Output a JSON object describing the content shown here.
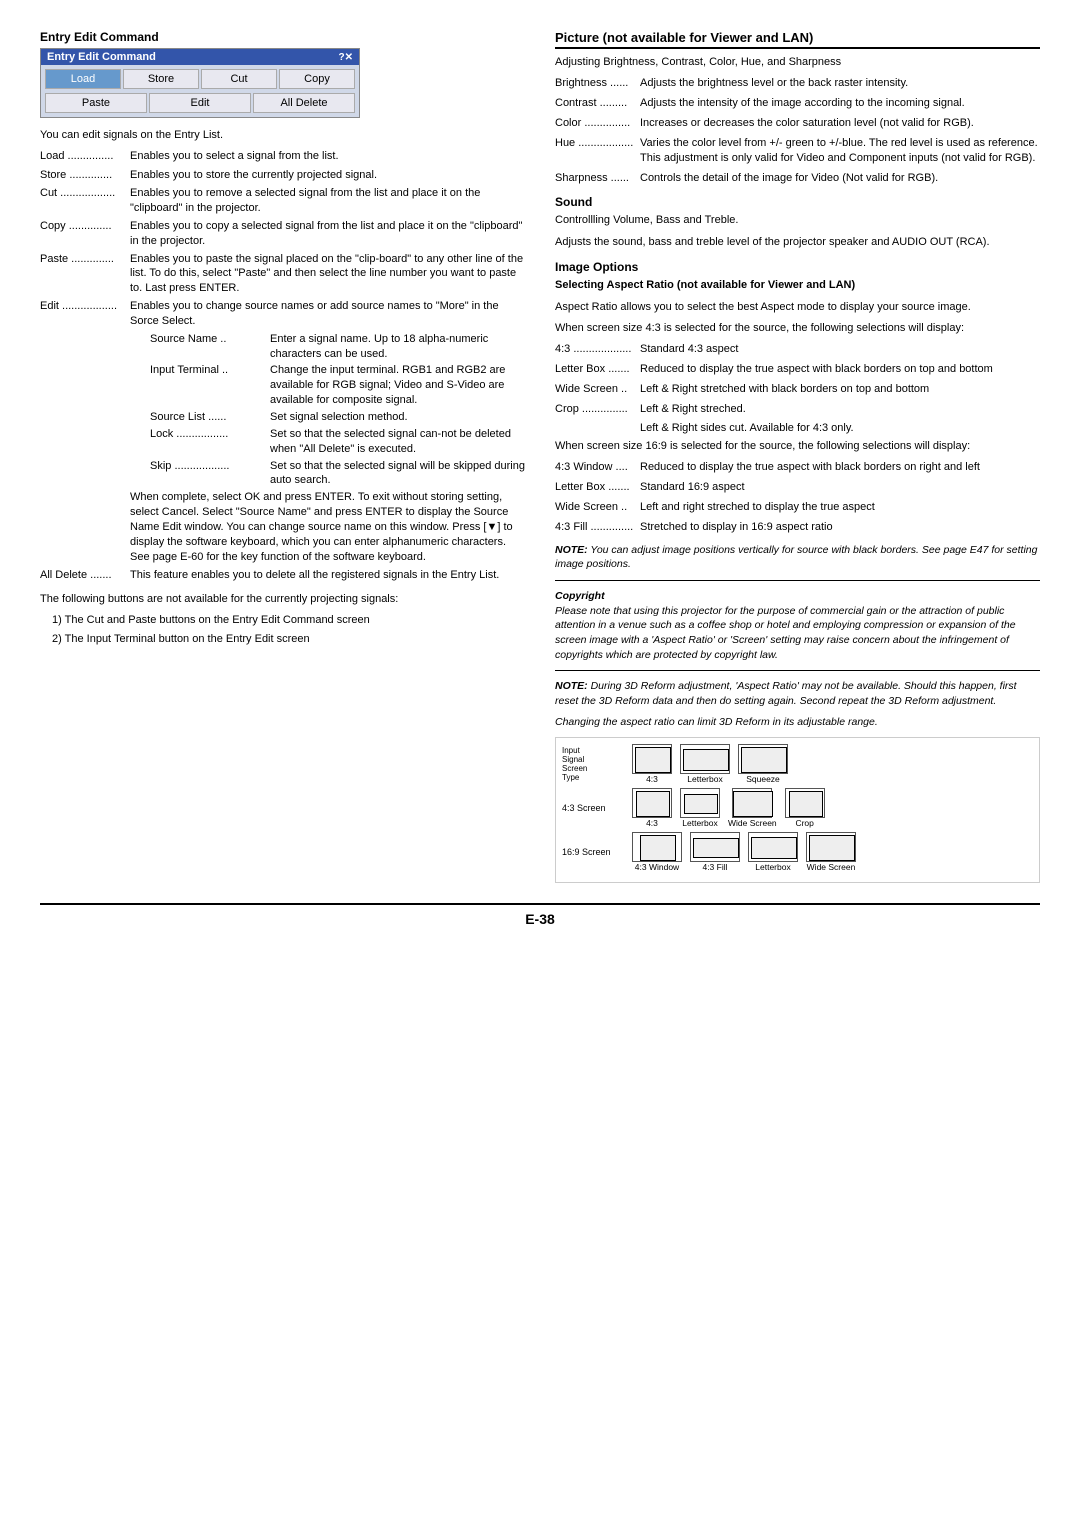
{
  "left": {
    "section_title": "Entry Edit Command",
    "buttons_row1": [
      "Load",
      "Store",
      "Cut",
      "Copy"
    ],
    "buttons_row2": [
      "Paste",
      "Edit",
      "All Delete"
    ],
    "intro": "You can edit signals on the Entry List.",
    "items": [
      {
        "term": "Load ...............",
        "def": "Enables you to select a signal from the list."
      },
      {
        "term": "Store ..............",
        "def": "Enables you to store the currently projected signal."
      },
      {
        "term": "Cut ..................",
        "def": "Enables you to remove a selected signal from the list and place it on the \"clipboard\" in the projector."
      },
      {
        "term": "Copy ..............",
        "def": "Enables you to copy a selected signal from the list and place it on the \"clipboard\" in the projector."
      },
      {
        "term": "Paste ..............",
        "def": "Enables you to paste the signal placed on the \"clip-board\" to any other line of the list. To do this, select \"Paste\" and then select the line number you want to paste to. Last press ENTER."
      },
      {
        "term": "Edit ..................",
        "def": "Enables you to change source names or add source names to \"More\" in the Sorce Select."
      }
    ],
    "edit_sub_items": [
      {
        "term": "Source Name ..",
        "def": "Enter a signal name. Up to 18 alpha-numeric characters can be used."
      },
      {
        "term": "Input Terminal ..",
        "def": "Change the input terminal. RGB1 and RGB2 are available for RGB signal; Video and S-Video are available for composite signal."
      },
      {
        "term": "Source List ......",
        "def": "Set signal selection method."
      },
      {
        "term": "Lock .................",
        "def": "Set so that the selected signal can-not be deleted when \"All Delete\" is executed."
      },
      {
        "term": "Skip ..................",
        "def": "Set so that the selected signal will be skipped during auto search."
      }
    ],
    "edit_paragraph": "When complete, select OK and press ENTER. To exit without storing setting, select Cancel. Select \"Source Name\" and press ENTER to display the Source Name Edit window. You can change source name on this window. Press [▼] to display the software keyboard, which you can enter alphanumeric characters. See page E-60 for the key function of the software keyboard.",
    "all_delete_item": {
      "term": "All Delete .......",
      "def": "This feature enables you to delete all the registered signals in the Entry List."
    },
    "footer_para": "The following buttons are not available for the currently projecting signals:",
    "numbered_items": [
      "1) The Cut and Paste buttons on the Entry Edit Command screen",
      "2) The Input Terminal button on the Entry Edit screen"
    ]
  },
  "right": {
    "section_title": "Picture (not available for Viewer and LAN)",
    "section_intro": "Adjusting Brightness, Contrast, Color, Hue, and Sharpness",
    "picture_items": [
      {
        "term": "Brightness ......",
        "def": "Adjusts the brightness level or the back raster intensity."
      },
      {
        "term": "Contrast .........",
        "def": "Adjusts the intensity of the image according to the incoming signal."
      },
      {
        "term": "Color ...............",
        "def": "Increases or decreases the color saturation level (not valid for RGB)."
      },
      {
        "term": "Hue ..................",
        "def": "Varies the color level from +/- green to +/-blue. The red level is used as reference. This adjustment is only valid for Video and Component inputs (not valid for RGB)."
      },
      {
        "term": "Sharpness ......",
        "def": "Controls the detail of the image for Video (Not valid for RGB)."
      }
    ],
    "sound_title": "Sound",
    "sound_intro": "Controllling Volume, Bass and Treble.",
    "sound_desc": "Adjusts the sound, bass and treble level of the projector speaker and AUDIO OUT (RCA).",
    "image_options_title": "Image Options",
    "aspect_ratio_subtitle": "Selecting Aspect Ratio (not available for Viewer and LAN)",
    "aspect_ratio_desc1": "Aspect Ratio allows you to select the best Aspect mode to display your source image.",
    "aspect_ratio_desc2": "When screen size 4:3 is selected for the source, the following selections will display:",
    "aspect_43_items": [
      {
        "term": "4:3 ...................",
        "def": "Standard 4:3 aspect"
      },
      {
        "term": "Letter Box .......",
        "def": "Reduced to display the true aspect with black borders on top and bottom"
      },
      {
        "term": "Wide Screen ..",
        "def": "Left & Right stretched with black borders on top and bottom"
      },
      {
        "term": "Crop ...............",
        "def": "Left & Right streched."
      }
    ],
    "crop_sub": "Left & Right sides cut. Available for 4:3 only.",
    "aspect_169_desc": "When screen size 16:9 is selected for the source, the following selections will display:",
    "aspect_169_items": [
      {
        "term": "4:3 Window ....",
        "def": "Reduced to display the true aspect with black borders on right and left"
      },
      {
        "term": "Letter Box .......",
        "def": "Standard 16:9 aspect"
      },
      {
        "term": "Wide Screen ..",
        "def": "Left and right streched to display the true aspect"
      },
      {
        "term": "4:3 Fill ..............",
        "def": "Stretched to display in 16:9 aspect ratio"
      }
    ],
    "note1_label": "NOTE:",
    "note1_text": " You can adjust image positions vertically for source with black borders. See page E47 for setting image positions.",
    "copyright_label": "Copyright",
    "copyright_text": "Please note that using this projector for the purpose of commercial gain or the attraction of public attention in a venue such as a coffee shop or hotel and employing compression or expansion of the screen image with a 'Aspect Ratio' or 'Screen' setting may raise concern about the infringement of copyrights which are protected by copyright law.",
    "note2_label": "NOTE:",
    "note2_text": " During 3D Reform adjustment, 'Aspect Ratio' may not be available. Should this happen, first reset the 3D Reform data and then do setting again. Second repeat the 3D Reform adjustment.",
    "note3_text": "Changing the aspect ratio can limit 3D Reform in its adjustable range."
  },
  "footer": {
    "page": "E-38"
  }
}
